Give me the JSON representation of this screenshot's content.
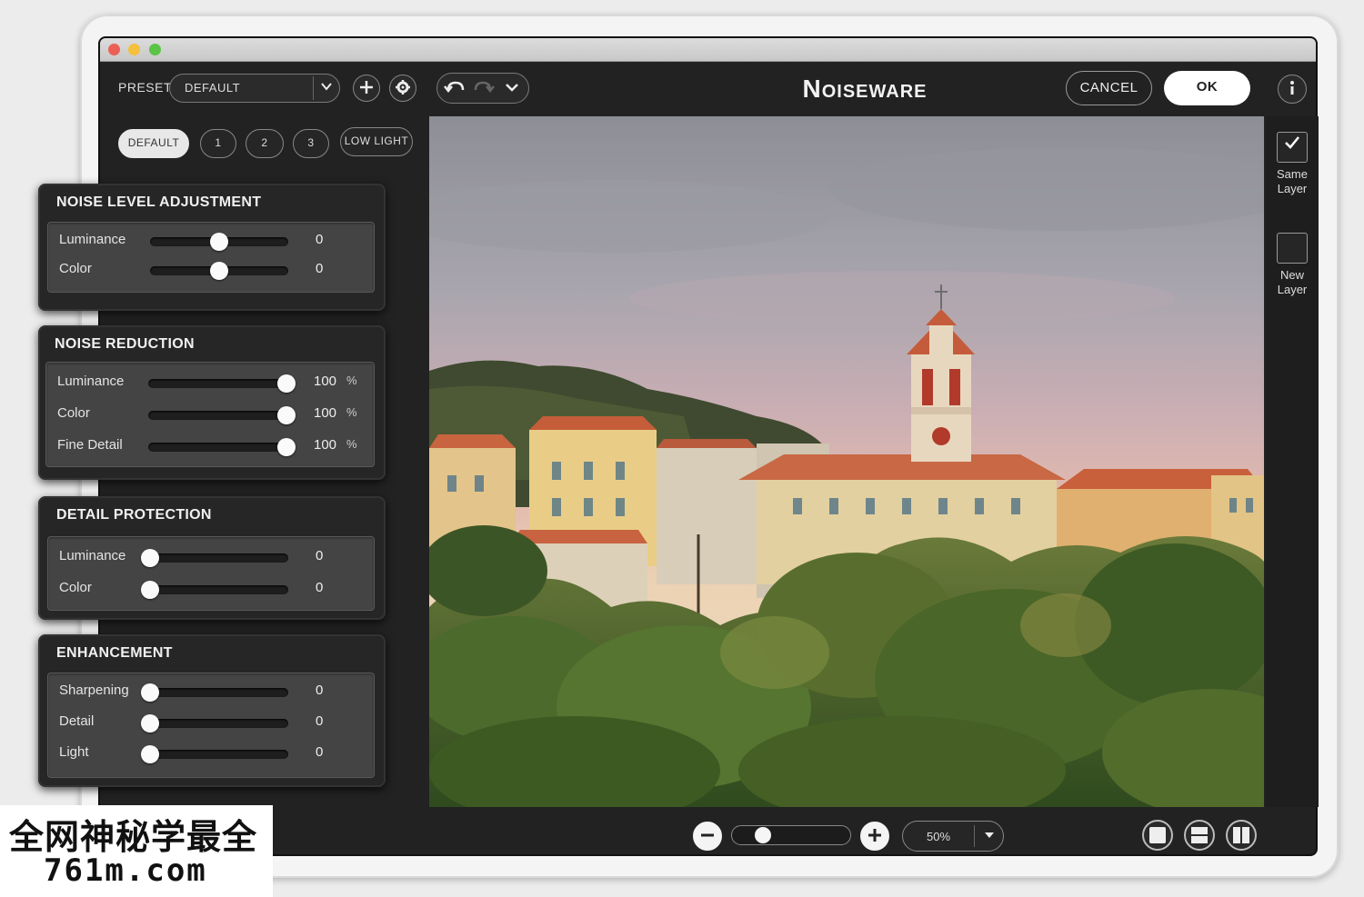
{
  "toolbar": {
    "preset_label": "PRESET",
    "preset_value": "DEFAULT",
    "app_title": "Noiseware",
    "cancel_label": "CANCEL",
    "ok_label": "OK"
  },
  "preset_tabs": [
    {
      "label": "DEFAULT",
      "active": true
    },
    {
      "label": "1",
      "active": false
    },
    {
      "label": "2",
      "active": false
    },
    {
      "label": "3",
      "active": false
    },
    {
      "label": "LOW LIGHT",
      "active": false
    }
  ],
  "panels": {
    "noise_level": {
      "title": "NOISE LEVEL ADJUSTMENT",
      "rows": [
        {
          "label": "Luminance",
          "value": "0",
          "unit": "",
          "position": 0.5
        },
        {
          "label": "Color",
          "value": "0",
          "unit": "",
          "position": 0.5
        }
      ]
    },
    "noise_reduction": {
      "title": "NOISE REDUCTION",
      "rows": [
        {
          "label": "Luminance",
          "value": "100",
          "unit": "%",
          "position": 1.0
        },
        {
          "label": "Color",
          "value": "100",
          "unit": "%",
          "position": 1.0
        },
        {
          "label": "Fine Detail",
          "value": "100",
          "unit": "%",
          "position": 1.0
        }
      ]
    },
    "detail_protection": {
      "title": "DETAIL PROTECTION",
      "rows": [
        {
          "label": "Luminance",
          "value": "0",
          "unit": "",
          "position": 0.0
        },
        {
          "label": "Color",
          "value": "0",
          "unit": "",
          "position": 0.0
        }
      ]
    },
    "enhancement": {
      "title": "ENHANCEMENT",
      "rows": [
        {
          "label": "Sharpening",
          "value": "0",
          "unit": "",
          "position": 0.0
        },
        {
          "label": "Detail",
          "value": "0",
          "unit": "",
          "position": 0.0
        },
        {
          "label": "Light",
          "value": "0",
          "unit": "",
          "position": 0.0
        }
      ]
    }
  },
  "layers": {
    "same_layer_label": "Same Layer",
    "same_layer_checked": true,
    "new_layer_label": "New Layer",
    "new_layer_checked": false
  },
  "zoom": {
    "value": "50%",
    "slider_position": 0.2
  },
  "watermark": {
    "line1": "全网神秘学最全",
    "line2": "761m.com"
  },
  "colors": {
    "accent_white": "#ffffff",
    "panel_bg": "#262626",
    "window_bg": "#222222"
  }
}
